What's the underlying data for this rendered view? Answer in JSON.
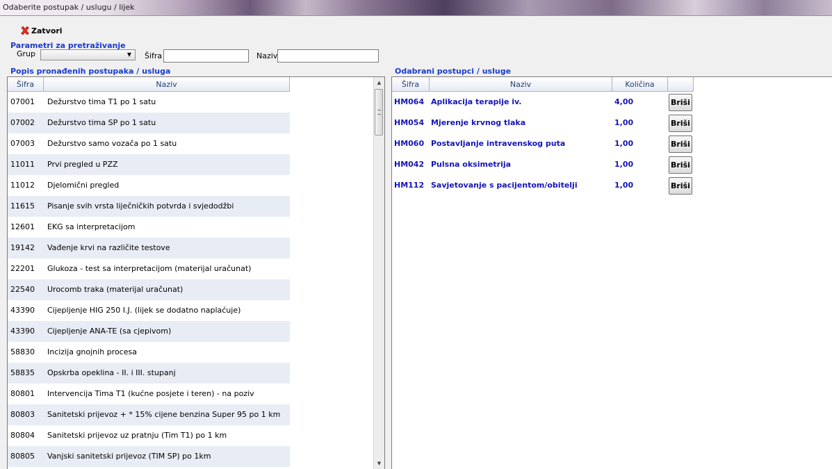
{
  "window": {
    "title": "Odaberite postupak / uslugu / lijek"
  },
  "toolbar": {
    "close_label": "Zatvori",
    "close_icon": "close-x-icon"
  },
  "search": {
    "section_title": "Parametri za pretraživanje",
    "group_label": "Grup",
    "group_value": "",
    "code_label": "Šifra",
    "code_value": "",
    "name_label": "Naziv",
    "name_value": ""
  },
  "found": {
    "title": "Popis pronađenih postupaka /  usluga",
    "columns": [
      "Šifra",
      "Naziv"
    ],
    "rows": [
      [
        "07001",
        "Dežurstvo tima T1 po 1 satu"
      ],
      [
        "07002",
        "Dežurstvo tima SP po 1 satu"
      ],
      [
        "07003",
        "Dežurstvo samo vozača po 1 satu"
      ],
      [
        "11011",
        "Prvi pregled u PZZ"
      ],
      [
        "11012",
        "Djelomični pregled"
      ],
      [
        "11615",
        "Pisanje svih vrsta liječničkih potvrda i svjedodžbi"
      ],
      [
        "12601",
        "EKG sa interpretacijom"
      ],
      [
        "19142",
        "Vađenje krvi na različite testove"
      ],
      [
        "22201",
        "Glukoza - test sa interpretacijom (materijal uračunat)"
      ],
      [
        "22540",
        "Urocomb traka (materijal uračunat)"
      ],
      [
        "43390",
        "Cijepljenje HIG 250 I.J. (lijek se dodatno naplaćuje)"
      ],
      [
        "43390",
        "Cijepljenje ANA-TE (sa cjepivom)"
      ],
      [
        "58830",
        "Incizija gnojnih procesa"
      ],
      [
        "58835",
        "Opskrba opeklina - II. i III. stupanj"
      ],
      [
        "80801",
        "Intervencija Tima T1 (kućne posjete i teren) - na poziv"
      ],
      [
        "80803",
        "Sanitetski prijevoz + * 15% cijene benzina Super 95 po 1 km"
      ],
      [
        "80804",
        "Sanitetski prijevoz uz pratnju (Tim T1) po 1 km"
      ],
      [
        "80805",
        "Vanjski sanitetski prijevoz (TIM SP) po 1km"
      ]
    ]
  },
  "selected": {
    "title": "Odabrani postupci / usluge",
    "columns": [
      "Šifra",
      "Naziv",
      "Količina",
      ""
    ],
    "delete_label": "Briši",
    "rows": [
      [
        "HM064",
        "Aplikacija terapije iv.",
        "4,00"
      ],
      [
        "HM054",
        "Mjerenje krvnog tlaka",
        "1,00"
      ],
      [
        "HM060",
        "Postavljanje intravenskog puta",
        "1,00"
      ],
      [
        "HM042",
        "Pulsna oksimetrija",
        "1,00"
      ],
      [
        "HM112",
        "Savjetovanje s pacijentom/obitelji",
        "1,00"
      ]
    ]
  },
  "colors": {
    "section_title": "#1a3bcc",
    "selected_text": "#1515b8",
    "row_alt": "#e8ecf5",
    "header_text": "#1f3d7a"
  }
}
